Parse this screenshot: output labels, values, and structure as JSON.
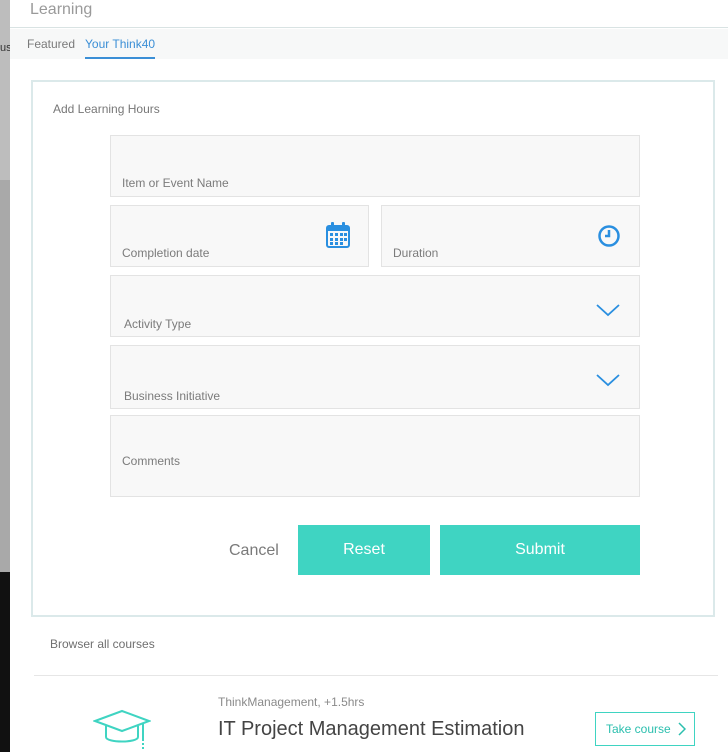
{
  "edge": {
    "clipped_text": "us"
  },
  "header": {
    "title": "Learning"
  },
  "tabs": [
    {
      "label": "Featured"
    },
    {
      "label": "Your Think40"
    }
  ],
  "form": {
    "title": "Add Learning Hours",
    "fields": {
      "item_name": "Item or Event Name",
      "completion_date": "Completion date",
      "duration": "Duration",
      "activity_type": "Activity Type",
      "business_initiative": "Business Initiative",
      "comments": "Comments"
    },
    "buttons": {
      "cancel": "Cancel",
      "reset": "Reset",
      "submit": "Submit"
    }
  },
  "browse": {
    "label": "Browser all courses"
  },
  "course": {
    "meta": "ThinkManagement,  +1.5hrs",
    "title": "IT Project Management Estimation",
    "action": "Take course"
  },
  "colors": {
    "accent": "#3fd4c2",
    "tab_active": "#3b8fd6",
    "icon_blue": "#2a8fe0"
  },
  "icons": [
    "calendar-icon",
    "clock-icon",
    "chevron-down-icon",
    "graduation-cap-icon",
    "chevron-right-icon"
  ]
}
